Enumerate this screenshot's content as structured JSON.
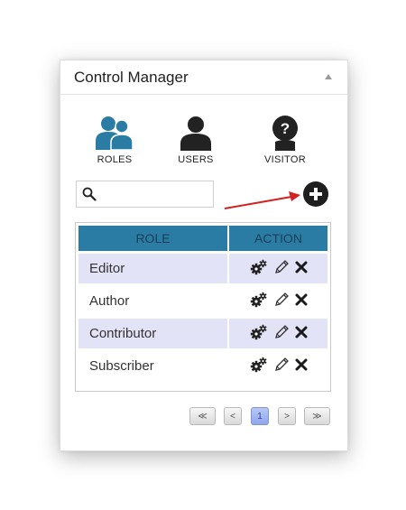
{
  "panel": {
    "title": "Control Manager"
  },
  "nav": [
    {
      "label": "ROLES",
      "icon": "users-group-icon",
      "color": "#2b7ca4"
    },
    {
      "label": "USERS",
      "icon": "user-icon",
      "color": "#222222"
    },
    {
      "label": "VISITOR",
      "icon": "visitor-question-icon",
      "color": "#222222"
    }
  ],
  "search": {
    "value": "",
    "placeholder": ""
  },
  "table": {
    "headers": {
      "role": "ROLE",
      "action": "ACTION"
    },
    "header_color": "#2b7ca4",
    "rows": [
      {
        "role": "Editor"
      },
      {
        "role": "Author"
      },
      {
        "role": "Contributor"
      },
      {
        "role": "Subscriber"
      }
    ],
    "row_actions": [
      "settings-icon",
      "edit-pencil-icon",
      "delete-x-icon"
    ]
  },
  "pagination": {
    "first": "≪",
    "prev": "<",
    "current": "1",
    "next": ">",
    "last": "≫"
  },
  "annotation_arrow_color": "#d42020"
}
